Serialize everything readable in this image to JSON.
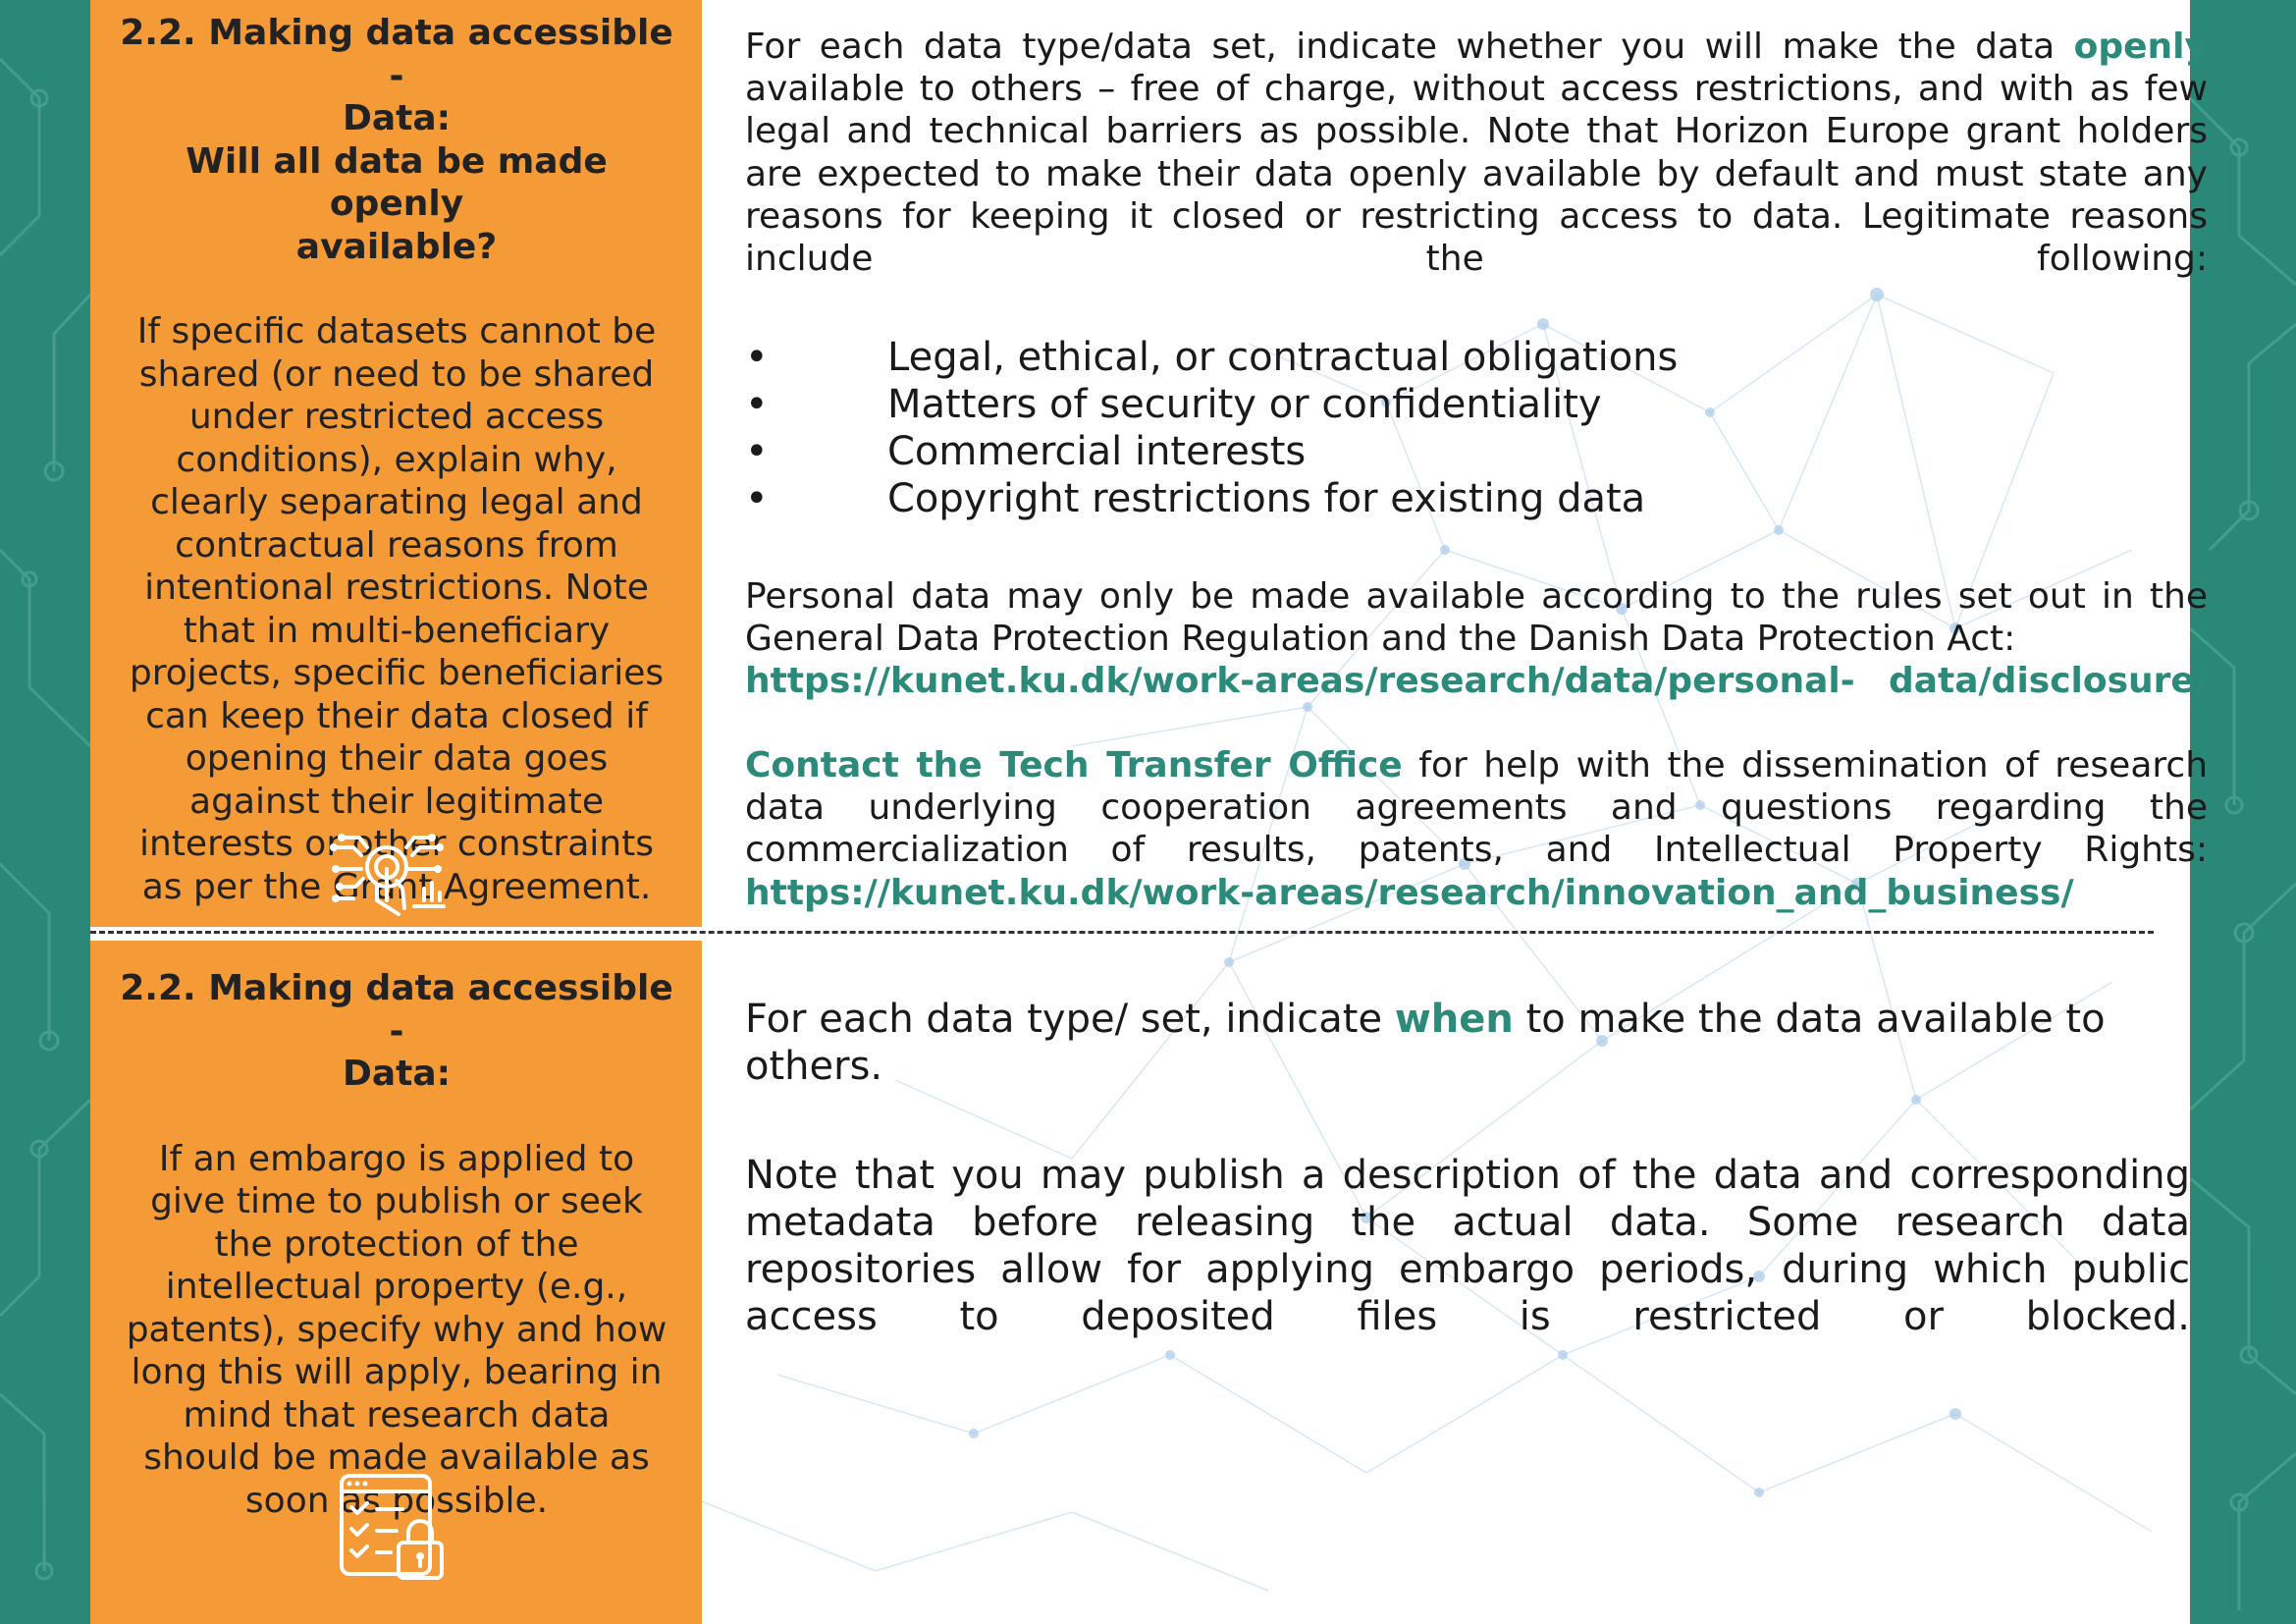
{
  "colors": {
    "accent_orange": "#f49a36",
    "teal": "#2b8a7a",
    "side_teal": "#2a8878",
    "divider": "#333333"
  },
  "panel1": {
    "title_lines": [
      "2.2. Making data accessible -",
      "Data:",
      "Will all data be made openly",
      "available?"
    ],
    "body": "If specific datasets cannot be shared (or need to be shared under restricted access conditions), explain why, clearly separating legal and contractual reasons from intentional restrictions. Note that in multi-beneficiary projects, specific beneficiaries can keep their data closed if opening their data goes against their legitimate interests or other constraints as per the Grant Agreement.",
    "icon": "touch-network-icon"
  },
  "panel2": {
    "title_lines": [
      "2.2. Making data accessible -",
      "Data:"
    ],
    "body": "If an embargo is applied to give time to publish or seek the protection of the intellectual property (e.g., patents), specify why and how long this will apply, bearing in mind that research data should be made available as soon as possible.",
    "icon": "checklist-lock-icon"
  },
  "section1": {
    "intro_before": "For each data type/data set, indicate whether you will make the data",
    "intro_highlight": "openly",
    "intro_after": "available to others – free of charge, without access restrictions, and with as few legal and technical barriers as possible. Note that Horizon Europe grant holders are expected to make their data openly available by default and must state any reasons for keeping it closed or restricting access to data. Legitimate reasons include the following:",
    "bullets": [
      "Legal, ethical, or contractual obligations",
      "Matters of security or confidentiality",
      "Commercial interests",
      "Copyright restrictions for existing data"
    ],
    "personal_data_text": "Personal data may only be made available according to the rules set out in the General Data Protection Regulation and the Danish Data Protection Act:",
    "personal_data_link": "https://kunet.ku.dk/work-areas/research/data/personal-  data/disclosure/",
    "contact_highlight": "Contact the Tech Transfer Office",
    "contact_text": "for help with the dissemination of research data underlying cooperation agreements and questions regarding the commercialization of results, patents, and Intellectual Property Rights:",
    "contact_link": "https://kunet.ku.dk/work-areas/research/innovation_and_business/"
  },
  "section2": {
    "intro_before": "For each data type/ set, indicate",
    "intro_highlight": "when",
    "intro_after": "to make the data available to others.",
    "note": "Note that you may publish a description of the data and corresponding metadata before releasing the actual data. Some research data repositories allow for applying embargo periods, during which public access to deposited files is restricted or blocked."
  }
}
